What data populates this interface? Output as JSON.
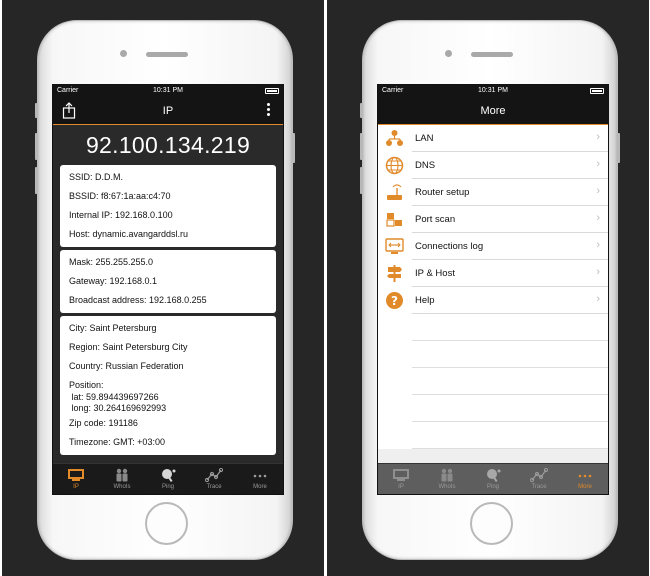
{
  "left": {
    "status": {
      "carrier": "Carrier",
      "time": "10:31 PM"
    },
    "nav_title": "IP",
    "ip_address": "92.100.134.219",
    "network": {
      "ssid": "SSID: D.D.M.",
      "bssid": "BSSID: f8:67:1a:aa:c4:70",
      "internal_ip": "Internal IP: 192.168.0.100",
      "host": "Host: dynamic.avangarddsl.ru"
    },
    "subnet": {
      "mask": "Mask: 255.255.255.0",
      "gateway": "Gateway: 192.168.0.1",
      "broadcast": "Broadcast address: 192.168.0.255"
    },
    "geo": {
      "city": "City: Saint Petersburg",
      "region": "Region: Saint Petersburg City",
      "country": "Country: Russian Federation",
      "position": "Position:",
      "lat": " lat: 59.894439697266",
      "long": " long: 30.264169692993",
      "zip": "Zip code: 191186",
      "timezone": "Timezone: GMT: +03:00"
    },
    "tabs": [
      "IP",
      "WhoIs",
      "Ping",
      "Trace",
      "More"
    ]
  },
  "right": {
    "status": {
      "carrier": "Carrier",
      "time": "10:31 PM"
    },
    "nav_title": "More",
    "items": [
      {
        "label": "LAN",
        "icon": "lan-icon"
      },
      {
        "label": "DNS",
        "icon": "globe-icon"
      },
      {
        "label": "Router setup",
        "icon": "router-icon"
      },
      {
        "label": "Port scan",
        "icon": "port-scan-icon"
      },
      {
        "label": "Connections log",
        "icon": "connections-log-icon"
      },
      {
        "label": "IP & Host",
        "icon": "signpost-icon"
      },
      {
        "label": "Help",
        "icon": "help-icon"
      }
    ],
    "tabs": [
      "IP",
      "WhoIs",
      "Ping",
      "Trace",
      "More"
    ]
  },
  "colors": {
    "accent": "#e08a2a",
    "dark": "#141414",
    "panel": "#262626"
  }
}
